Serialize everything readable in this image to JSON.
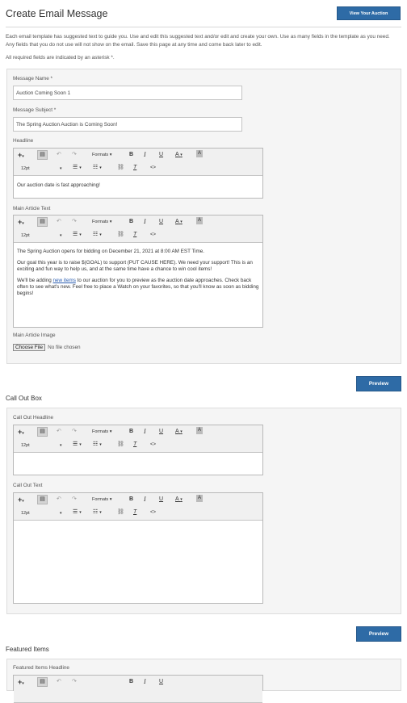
{
  "header": {
    "title": "Create Email Message",
    "view_auction_label": "View Your Auction"
  },
  "intro": {
    "text": "Each email template has suggested text to guide you. Use and edit this suggested text and/or edit and create your own. Use as many fields in the template as you need. Any fields that you do not use will not show on the email. Save this page at any time and come back later to edit.",
    "required_note": "All required fields are indicated by an asterisk *."
  },
  "toolbar": {
    "formats_label": "Formats",
    "size_label": "12pt",
    "bold": "B",
    "italic": "I",
    "underline": "U",
    "font_color": "A",
    "bg_color": "A",
    "code": "<>"
  },
  "message": {
    "name_label": "Message Name *",
    "name_value": "Auction Coming Soon 1",
    "subject_label": "Message Subject *",
    "subject_value": "The Spring Auction Auction is Coming Soon!",
    "headline_label": "Headline",
    "headline_text": "Our auction date is fast approaching!",
    "article_label": "Main Article Text",
    "article_p1": "The Spring Auction opens for bidding on December 21, 2021 at 8:00 AM EST Time.",
    "article_p2": "Our goal this year is to raise $(GOAL) to support (PUT CAUSE HERE). We need your support! This is an exciting and fun way to help us, and at the same time have a chance to win cool items!",
    "article_p3_before": "We'll be adding ",
    "article_p3_link": "new items",
    "article_p3_after": " to our auction for you to preview as the auction date approaches. Check back often to see what's new. Feel free to place a Watch on your favorites, so that you'll know as soon as bidding begins!",
    "image_label": "Main Article Image",
    "choose_file_label": "Choose File",
    "no_file_label": "No file chosen"
  },
  "preview_label": "Preview",
  "callout": {
    "section_title": "Call Out Box",
    "headline_label": "Call Out Headline",
    "text_label": "Call Out Text"
  },
  "featured": {
    "section_title": "Featured Items",
    "headline_label": "Featured Items Headline"
  }
}
